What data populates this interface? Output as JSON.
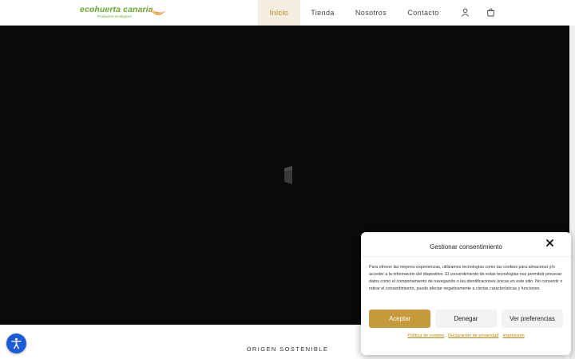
{
  "header": {
    "logo": {
      "part1": "eco",
      "part2": "huerta",
      "part3": "canaria",
      "tagline": "Productos ecológicos"
    },
    "nav": [
      {
        "label": "Inicio",
        "active": true
      },
      {
        "label": "Tienda",
        "active": false
      },
      {
        "label": "Nosotros",
        "active": false
      },
      {
        "label": "Contacto",
        "active": false
      }
    ],
    "icons": {
      "account": "user-icon",
      "cart": "shopping-bag-icon"
    }
  },
  "hero": {
    "background": "#0a0a0a"
  },
  "section": {
    "origin_title": "ORIGEN SOSTENIBLE"
  },
  "accessibility": {
    "icon": "accessibility-icon",
    "color": "#1a5bd6"
  },
  "consent": {
    "title": "Gestionar consentimiento",
    "body": "Para ofrecer las mejores experiencias, utilizamos tecnologías como las cookies para almacenar y/o acceder a la información del dispositivo. El consentimiento de estas tecnologías nos permitirá procesar datos como el comportamiento de navegación o las identificaciones únicas en este sitio. No consentir o retirar el consentimiento, puede afectar negativamente a ciertas características y funciones.",
    "buttons": {
      "accept": "Aceptar",
      "deny": "Denegar",
      "preferences": "Ver preferencias"
    },
    "links": {
      "cookies": "Política de cookies",
      "privacy": "Declaración de privacidad",
      "impressum": "Impressum"
    },
    "accent": "#c69a3b"
  }
}
